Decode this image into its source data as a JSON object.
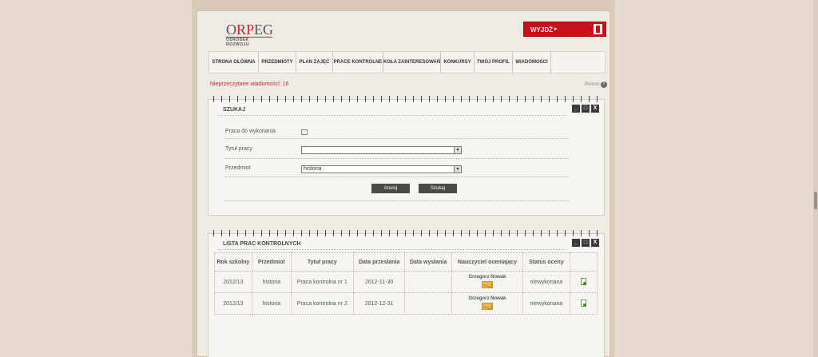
{
  "header": {
    "logo_main_1": "O",
    "logo_main_red": "RP",
    "logo_main_2": "EG",
    "logo_sub": "OŚRODEK ROZWOJU",
    "exit_label": "WYJDŹ",
    "exit_arrow": "▸"
  },
  "nav": {
    "items": [
      "STRONA GŁÓWNA",
      "PRZEDMIOTY",
      "PLAN ZAJĘĆ",
      "PRACE KONTROLNE",
      "KOŁA ZAINTERESOWAŃ",
      "KONKURSY",
      "TWÓJ PROFIL",
      "WIADOMOŚCI"
    ]
  },
  "unread_messages": "Nieprzeczytane wiadomości: 16",
  "help": {
    "label": "Pomoc",
    "icon": "?"
  },
  "search_panel": {
    "title": "SZUKAJ",
    "controls": [
      "_",
      "□",
      "X"
    ],
    "fields": {
      "todo_label": "Praca do wykonania",
      "title_label": "Tytuł pracy",
      "title_value": "",
      "subject_label": "Przedmiot",
      "subject_value": "historia"
    },
    "cancel_label": "Anuluj",
    "search_label": "Szukaj"
  },
  "list_panel": {
    "title": "LISTA PRAC KONTROLNYCH",
    "controls": [
      "_",
      "□",
      "X"
    ],
    "columns": [
      "Rok szkolny",
      "Przedmiot",
      "Tytuł pracy",
      "Data przesłania",
      "Data wysłania",
      "Nauczyciel oceniający",
      "Status oceny",
      ""
    ],
    "rows": [
      {
        "year": "2012/13",
        "subject": "historia",
        "title": "Praca kontrolna nr 1",
        "sent_date": "2012-11-30",
        "dispatch_date": "",
        "teacher": "Grzegorz Nowak",
        "status": "niewykonana"
      },
      {
        "year": "2012/13",
        "subject": "historia",
        "title": "Praca kontrolna nr 2",
        "sent_date": "2012-12-31",
        "dispatch_date": "",
        "teacher": "Grzegorz Nowak",
        "status": "niewykonana"
      }
    ]
  },
  "colors": {
    "accent_red": "#c8101c",
    "button_dark": "#4a4a4a"
  }
}
